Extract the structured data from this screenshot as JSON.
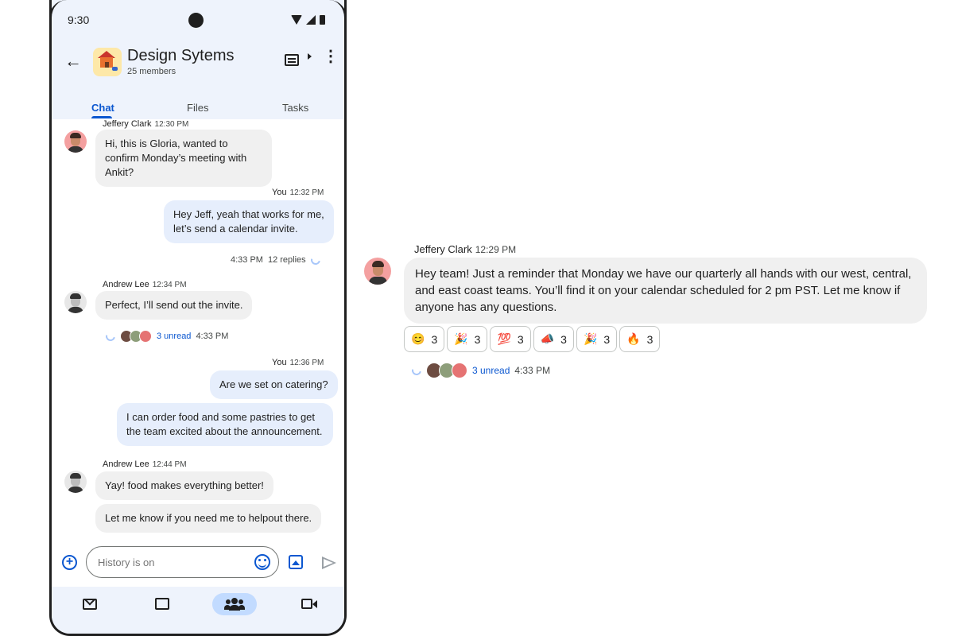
{
  "status_bar": {
    "time": "9:30"
  },
  "header": {
    "title": "Design Sytems",
    "subtitle": "25 members"
  },
  "tabs": [
    {
      "label": "Chat",
      "active": true
    },
    {
      "label": "Files",
      "active": false
    },
    {
      "label": "Tasks",
      "active": false
    }
  ],
  "messages": {
    "m1": {
      "sender": "Jeffery Clark",
      "time": "12:30 PM",
      "text": "Hi, this is Gloria, wanted to confirm Monday’s meeting with Ankit?"
    },
    "m2": {
      "sender": "You",
      "time": "12:32 PM",
      "text": "Hey Jeff, yeah that works for me, let’s send a calendar invite.",
      "thread_time": "4:33 PM",
      "replies": "12 replies"
    },
    "m3": {
      "sender": "Andrew Lee",
      "time": "12:34 PM",
      "text": "Perfect, I’ll send out the invite.",
      "unread": "3 unread",
      "thread_time": "4:33 PM"
    },
    "m4": {
      "sender": "You",
      "time": "12:36 PM",
      "text": "Are we set on catering?",
      "text2": "I can order food and some pastries to get the team excited about the announcement."
    },
    "m5": {
      "sender": "Andrew Lee",
      "time": "12:44 PM",
      "text": "Yay! food makes everything better!",
      "text2": "Let me know if you need me to helpout there."
    }
  },
  "composer": {
    "placeholder": "History is on"
  },
  "detail": {
    "sender": "Jeffery Clark",
    "time": "12:29 PM",
    "text": "Hey team! Just a reminder that Monday we have our quarterly all hands with our west, central, and east coast teams. You’ll find it on your calendar scheduled for 2 pm PST. Let me know if anyone has any questions.",
    "reactions": [
      {
        "emoji": "😊",
        "count": "3"
      },
      {
        "emoji": "🎉",
        "count": "3"
      },
      {
        "emoji": "💯",
        "count": "3"
      },
      {
        "emoji": "📣",
        "count": "3"
      },
      {
        "emoji": "🎉",
        "count": "3"
      },
      {
        "emoji": "🔥",
        "count": "3"
      }
    ],
    "unread": "3 unread",
    "thread_time": "4:33 PM"
  },
  "colors": {
    "accent": "#0b57d0",
    "header_bg": "#eef3fc",
    "bubble_out": "#e6eefc",
    "bubble_in": "#f0f0f0",
    "nav_active": "#c2dbff"
  }
}
